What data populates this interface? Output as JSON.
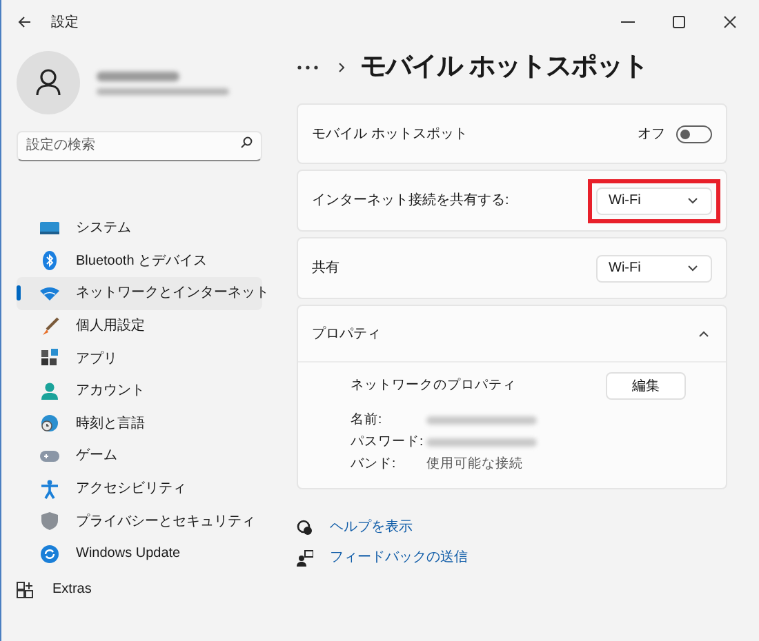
{
  "window": {
    "title": "設定"
  },
  "account": {
    "name_redacted": true,
    "email_redacted": true
  },
  "search": {
    "placeholder": "設定の検索"
  },
  "sidebar": {
    "items": [
      {
        "label": "システム",
        "kind": "nav",
        "selected": false
      },
      {
        "label": "Bluetooth とデバイス",
        "kind": "nav",
        "selected": false
      },
      {
        "label": "ネットワークとインターネット",
        "kind": "nav",
        "selected": true
      },
      {
        "label": "個人用設定",
        "kind": "nav",
        "selected": false
      },
      {
        "label": "アプリ",
        "kind": "nav",
        "selected": false
      },
      {
        "label": "アカウント",
        "kind": "nav",
        "selected": false
      },
      {
        "label": "時刻と言語",
        "kind": "nav",
        "selected": false
      },
      {
        "label": "ゲーム",
        "kind": "nav",
        "selected": false
      },
      {
        "label": "アクセシビリティ",
        "kind": "nav",
        "selected": false
      },
      {
        "label": "プライバシーとセキュリティ",
        "kind": "nav",
        "selected": false
      },
      {
        "label": "Windows Update",
        "kind": "nav",
        "selected": false
      },
      {
        "label": "Extras",
        "kind": "extra",
        "selected": false
      }
    ]
  },
  "page": {
    "title": "モバイル ホットスポット"
  },
  "settings": [
    {
      "kind": "toggle",
      "label": "モバイル ホットスポット",
      "state_label": "オフ",
      "on": false
    },
    {
      "kind": "dropdown",
      "label": "インターネット接続を共有する:",
      "value": "Wi-Fi",
      "highlighted": true
    },
    {
      "kind": "dropdown",
      "label": "共有",
      "value": "Wi-Fi",
      "highlighted": false
    },
    {
      "kind": "expander",
      "label": "プロパティ",
      "expanded": true,
      "section_label": "ネットワークのプロパティ",
      "button": "編集",
      "properties": [
        {
          "label": "名前:",
          "redacted": true
        },
        {
          "label": "パスワード:",
          "redacted": true
        },
        {
          "label": "バンド:",
          "value": "使用可能な接続",
          "redacted": false
        }
      ]
    }
  ],
  "links": [
    {
      "kind": "help",
      "label": "ヘルプを表示"
    },
    {
      "kind": "feedback",
      "label": "フィードバックの送信"
    }
  ]
}
